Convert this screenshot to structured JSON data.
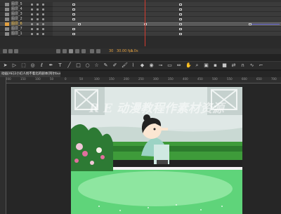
{
  "timeline": {
    "layers": [
      {
        "name": "图层_5",
        "selected": false
      },
      {
        "name": "图层_4",
        "selected": false
      },
      {
        "name": "图层_3",
        "selected": false
      },
      {
        "name": "图层_2",
        "selected": false
      },
      {
        "name": "图层_6",
        "selected": true
      },
      {
        "name": "图层_7",
        "selected": false
      },
      {
        "name": "图层_1",
        "selected": false
      }
    ],
    "footer": {
      "frame": "30",
      "fps": "30.00 fps",
      "time": "1.0s"
    }
  },
  "tools": [
    "selection-icon",
    "subselection-icon",
    "free-transform-icon",
    "3d-rotation-icon",
    "lasso-icon",
    "pen-icon",
    "text-icon",
    "line-icon",
    "rectangle-icon",
    "oval-icon",
    "polystar-icon",
    "pencil-icon",
    "brush-icon",
    "paint-brush-icon",
    "bone-icon",
    "paint-bucket-icon",
    "ink-bottle-icon",
    "eyedropper-icon",
    "eraser-icon",
    "width-icon",
    "hand-icon",
    "zoom-icon",
    "camera-icon",
    "stroke-color-icon",
    "fill-color-icon",
    "swap-colors-icon",
    "snap-icon",
    "smooth-icon",
    "straighten-icon"
  ],
  "document": {
    "tab_label": "动画[AE]2小幻人找不着北的剧本[阿尔bum]的视频"
  },
  "ruler": {
    "marks": [
      "200",
      "150",
      "100",
      "50",
      "0",
      "50",
      "100",
      "150",
      "200",
      "250",
      "300",
      "350",
      "400",
      "450",
      "500",
      "550",
      "600",
      "650",
      "700"
    ]
  },
  "stage": {
    "watermark": "R E 动漫教程作素材资源"
  },
  "colors": {
    "accent": "#e3a140",
    "playhead": "#d43a2f",
    "selection_row": "#4a4a4a"
  }
}
